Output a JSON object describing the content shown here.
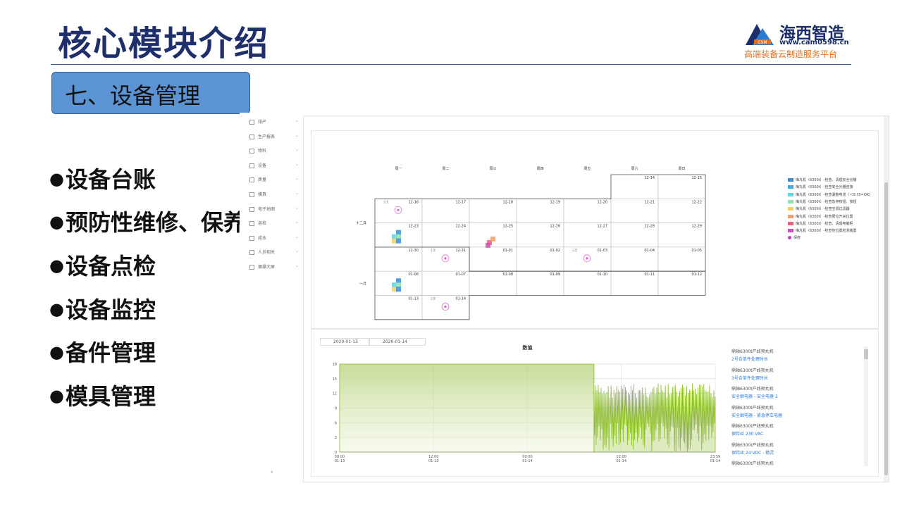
{
  "slide": {
    "title": "核心模块介绍",
    "section": "七、设备管理",
    "bullets": [
      "设备台账",
      "预防性维修、保养",
      "设备点检",
      "设备监控",
      "备件管理",
      "模具管理"
    ]
  },
  "logo": {
    "mark_text": "CSM",
    "name": "海西智造",
    "url": "www.cam0598.cn",
    "tagline": "高端装备云制造服务平台"
  },
  "sidebar": {
    "items": [
      {
        "label": "排产"
      },
      {
        "label": "生产报表"
      },
      {
        "label": "物料"
      },
      {
        "label": "设备"
      },
      {
        "label": "质量"
      },
      {
        "label": "模具"
      },
      {
        "label": "电子地图"
      },
      {
        "label": "巡检"
      },
      {
        "label": "成本"
      },
      {
        "label": "人员相关"
      },
      {
        "label": "捆操大屏"
      }
    ],
    "collapse_icon": "chevron-left-icon"
  },
  "calendar": {
    "weekdays": [
      "周一",
      "周二",
      "周三",
      "周四",
      "周五",
      "周六",
      "周日"
    ],
    "month_labels": [
      "十二月",
      "一月"
    ],
    "week1": [
      "",
      "",
      "",
      "",
      "",
      "12-14",
      "12-15"
    ],
    "week2": [
      "12-16",
      "12-17",
      "12-18",
      "12-19",
      "12-20",
      "12-21",
      "12-22"
    ],
    "week3": [
      "12-23",
      "12-24",
      "12-25",
      "12-26",
      "12-27",
      "12-28",
      "12-29"
    ],
    "week4": [
      "12-30",
      "12-31",
      "01-01",
      "01-02",
      "01-03",
      "01-04",
      "01-05"
    ],
    "week5": [
      "01-06",
      "01-07",
      "01-08",
      "01-09",
      "01-10",
      "01-11",
      "01-12"
    ],
    "week6": [
      "01-13",
      "01-14",
      "",
      "",
      "",
      "",
      ""
    ],
    "count_marks": [
      "1次",
      "1次",
      "2次",
      "2次"
    ],
    "legend": [
      {
        "label": "梅丸机（6300t）-检查、清理安全光栅",
        "color": "#3a8fd6"
      },
      {
        "label": "梅丸机（6300t）-检查安全光栅连接",
        "color": "#3bb0e0"
      },
      {
        "label": "梅丸机（6300t）-检查漏整电流（＜0.35=OK）",
        "color": "#5fd3e8"
      },
      {
        "label": "梅丸机（6300t）-检查急停按钮、按钮",
        "color": "#8fe0b0"
      },
      {
        "label": "梅丸机（6300t）-检查空调过滤器",
        "color": "#f0d060"
      },
      {
        "label": "梅丸机（6300t）-检查限位开关位置",
        "color": "#f0a070"
      },
      {
        "label": "梅丸机（6300t）-检查、清理电脑柜",
        "color": "#e86080"
      },
      {
        "label": "梅丸机（6300t）-检查他位置检测装置",
        "color": "#d050b0"
      },
      {
        "label": "保修",
        "color": "#c040c0"
      }
    ]
  },
  "chart_panel": {
    "date_from": "2020-01-13",
    "date_to": "2020-01-14",
    "list": [
      {
        "title": "鼎轴6300t产线预丸机",
        "sub": "2号合单件处理时长"
      },
      {
        "title": "鼎轴6300t产线预丸机",
        "sub": "3号合单件处理时长"
      },
      {
        "title": "鼎轴6300t产线预丸机",
        "sub": "安全继电器 - 安全电器 2"
      },
      {
        "title": "鼎轴6300t产线预丸机",
        "sub": "安全继电器 - 紧急停车电器"
      },
      {
        "title": "鼎轴6300t产线预丸机",
        "sub": "保险丝 230 VAC"
      },
      {
        "title": "鼎轴6300t产线预丸机",
        "sub": "保险丝 24 VDC - 精灵"
      },
      {
        "title": "鼎轴6300t产线预丸机",
        "sub": ""
      }
    ]
  },
  "chart_data": {
    "type": "area",
    "title": "数值",
    "ylim": [
      0,
      18
    ],
    "y_ticks": [
      0,
      3,
      6,
      9,
      12,
      15,
      18
    ],
    "x_ticks": [
      {
        "time": "00:00",
        "date": "01-13"
      },
      {
        "time": "12:00",
        "date": "01-13"
      },
      {
        "time": "00:00",
        "date": "01-14"
      },
      {
        "time": "12:00",
        "date": "01-14"
      },
      {
        "time": "23:59",
        "date": "01-14"
      }
    ],
    "series": [
      {
        "segment": "flat",
        "x_range_hours": [
          0,
          32.5
        ],
        "value": 18
      },
      {
        "segment": "oscillating",
        "x_range_hours": [
          32.5,
          48
        ],
        "min": 0,
        "max": 14
      }
    ],
    "color": "#8cbc2c",
    "grid": true
  }
}
